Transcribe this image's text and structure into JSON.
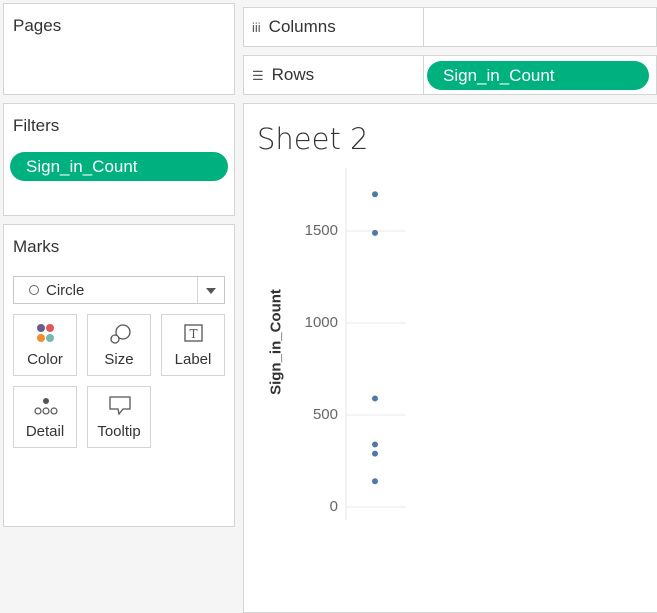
{
  "sidebar": {
    "pages": {
      "title": "Pages"
    },
    "filters": {
      "title": "Filters",
      "pills": [
        "Sign_in_Count"
      ]
    },
    "marks": {
      "title": "Marks",
      "mark_type": "Circle",
      "buttons": [
        {
          "label": "Color",
          "icon": "color-icon"
        },
        {
          "label": "Size",
          "icon": "size-icon"
        },
        {
          "label": "Label",
          "icon": "label-icon"
        },
        {
          "label": "Detail",
          "icon": "detail-icon"
        },
        {
          "label": "Tooltip",
          "icon": "tooltip-icon"
        }
      ]
    }
  },
  "shelves": {
    "columns": {
      "label": "Columns",
      "icon": "columns-icon",
      "pills": []
    },
    "rows": {
      "label": "Rows",
      "icon": "rows-icon",
      "pills": [
        "Sign_in_Count"
      ]
    }
  },
  "colors": {
    "pill": "#00b180",
    "mark": "#4e79a7",
    "color_swatches": [
      "#6d5b8c",
      "#e15759",
      "#f28e2b",
      "#76b7b2"
    ]
  },
  "sheet": {
    "title": "Sheet 2"
  },
  "chart_data": {
    "type": "scatter",
    "title": "",
    "xlabel": "",
    "ylabel": "Sign_in_Count",
    "ylim": [
      0,
      1750
    ],
    "yticks": [
      0,
      500,
      1000,
      1500
    ],
    "ytick_labels": [
      "0",
      "500",
      "1000",
      "1500"
    ],
    "grid": true,
    "series": [
      {
        "values": [
          1700,
          1490,
          590,
          340,
          290,
          140
        ]
      }
    ]
  }
}
